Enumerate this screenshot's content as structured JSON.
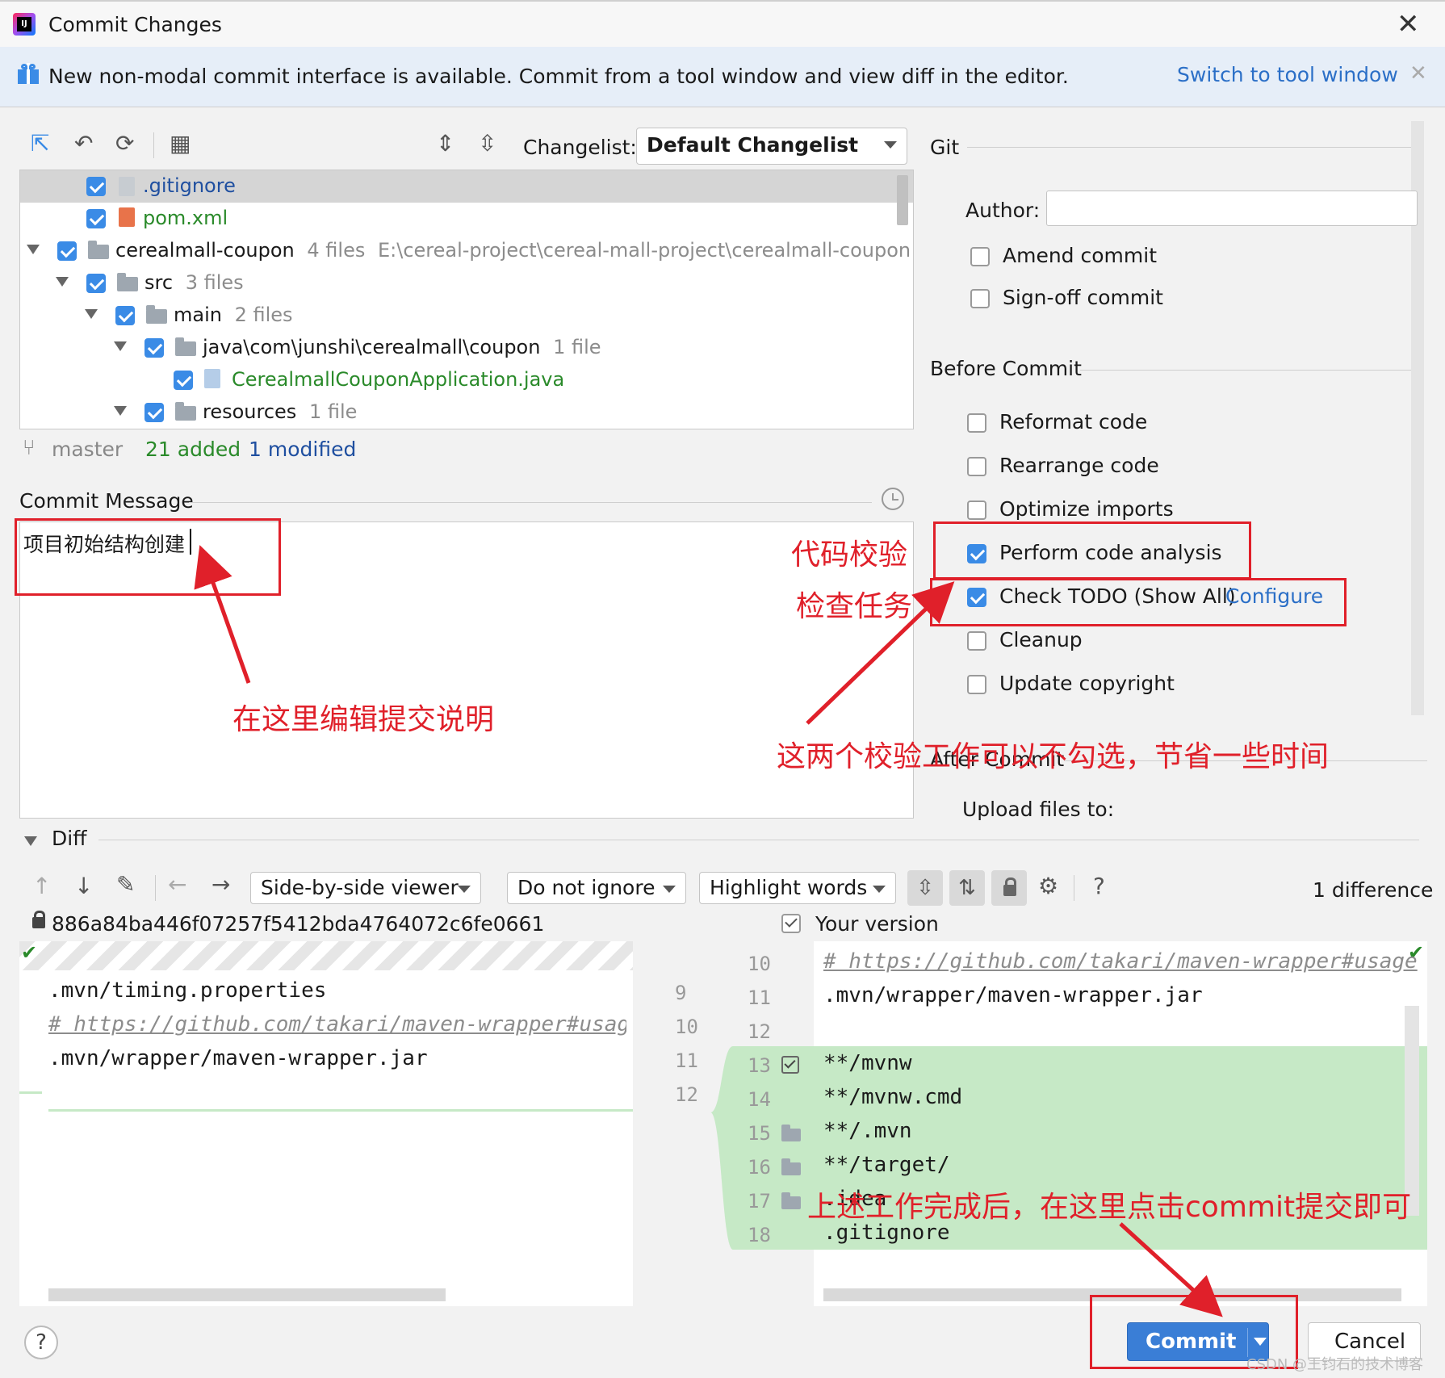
{
  "window": {
    "title": "Commit Changes"
  },
  "banner": {
    "text": "New non-modal commit interface is available. Commit from a tool window and view diff in the editor.",
    "link": "Switch to tool window"
  },
  "changes": {
    "changelist_label": "Changelist:",
    "changelist_value": "Default Changelist",
    "tree": [
      {
        "name": ".gitignore",
        "meta": ""
      },
      {
        "name": "pom.xml",
        "meta": ""
      },
      {
        "name": "cerealmall-coupon",
        "meta": "4 files",
        "path": "E:\\cereal-project\\cereal-mall-project\\cerealmall-coupon"
      },
      {
        "name": "src",
        "meta": "3 files"
      },
      {
        "name": "main",
        "meta": "2 files"
      },
      {
        "name": "java\\com\\junshi\\cerealmall\\coupon",
        "meta": "1 file"
      },
      {
        "name": "CerealmallCouponApplication.java",
        "meta": ""
      },
      {
        "name": "resources",
        "meta": "1 file"
      }
    ],
    "branch": "master",
    "added": "21 added",
    "modified": "1 modified"
  },
  "commit_message": {
    "label": "Commit Message",
    "value": "项目初始结构创建"
  },
  "git": {
    "title": "Git",
    "author_label": "Author:",
    "author_value": "",
    "amend": "Amend commit",
    "signoff": "Sign-off commit"
  },
  "before_commit": {
    "title": "Before Commit",
    "reformat": "Reformat code",
    "rearrange": "Rearrange code",
    "optimize": "Optimize imports",
    "analysis": "Perform code analysis",
    "todo": "Check TODO (Show All)",
    "configure": "Configure",
    "cleanup": "Cleanup",
    "copyright": "Update copyright"
  },
  "after_commit": {
    "title": "After Commit",
    "upload": "Upload files to:"
  },
  "diff": {
    "title": "Diff",
    "viewer": "Side-by-side viewer",
    "ignore": "Do not ignore",
    "highlight": "Highlight words",
    "count": "1 difference",
    "left_hash": "886a84ba446f07257f5412bda4764072c6fe0661",
    "right_title": "Your version",
    "left_lines": [
      ".mvn/timing.properties",
      "# https://github.com/takari/maven-wrapper#usage",
      ".mvn/wrapper/maven-wrapper.jar"
    ],
    "left_nums": [
      "9",
      "10",
      "11",
      "12"
    ],
    "right_nums": [
      "10",
      "11",
      "12",
      "13",
      "14",
      "15",
      "16",
      "17",
      "18"
    ],
    "right_lines": [
      "# https://github.com/takari/maven-wrapper#usage",
      ".mvn/wrapper/maven-wrapper.jar",
      "",
      "**/mvnw",
      "**/mvnw.cmd",
      "**/.mvn",
      "**/target/",
      ".idea",
      ".gitignore"
    ]
  },
  "buttons": {
    "commit": "Commit",
    "cancel": "Cancel",
    "help": "?"
  },
  "annotations": {
    "edit_message": "在这里编辑提交说明",
    "code_check": "代码校验",
    "check_task": "检查任务",
    "uncheck_tip": "这两个校验工作可以不勾选，节省一些时间",
    "commit_tip": "上述工作完成后，在这里点击commit提交即可",
    "watermark": "CSDN @王钧石的技术博客"
  }
}
